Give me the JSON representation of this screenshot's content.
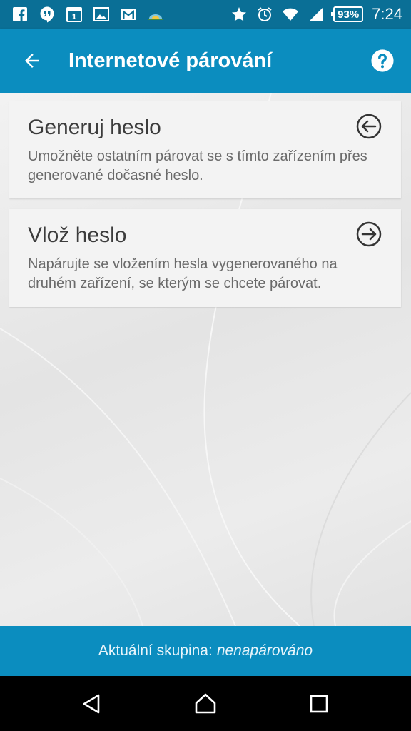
{
  "status_bar": {
    "time": "7:24",
    "battery": "93%",
    "icons_left": [
      "facebook-icon",
      "hangouts-icon",
      "calendar-icon",
      "gallery-icon",
      "gmail-icon",
      "weather-icon"
    ],
    "icons_right": [
      "star-icon",
      "alarm-icon",
      "wifi-icon",
      "signal-icon",
      "battery-icon"
    ]
  },
  "app_bar": {
    "title": "Internetové párování",
    "back_icon": "arrow-left-icon",
    "help_icon": "help-icon"
  },
  "options": [
    {
      "title": "Generuj heslo",
      "description": "Umožněte ostatním párovat se s tímto zařízením přes generované dočasné heslo.",
      "icon": "circle-arrow-left-icon"
    },
    {
      "title": "Vlož heslo",
      "description": "Napárujte se vložením hesla vygenerovaného na druhém zařízení, se kterým se chcete párovat.",
      "icon": "circle-arrow-right-icon"
    }
  ],
  "group_bar": {
    "label": "Aktuální skupina:",
    "value": "nenapárováno"
  },
  "nav_bar": {
    "buttons": [
      "back-nav-icon",
      "home-nav-icon",
      "recents-nav-icon"
    ]
  },
  "colors": {
    "status_bar": "#0a6f96",
    "app_bar": "#0b8dbf",
    "group_bar": "#0b8dbf",
    "nav_bar": "#000000"
  }
}
